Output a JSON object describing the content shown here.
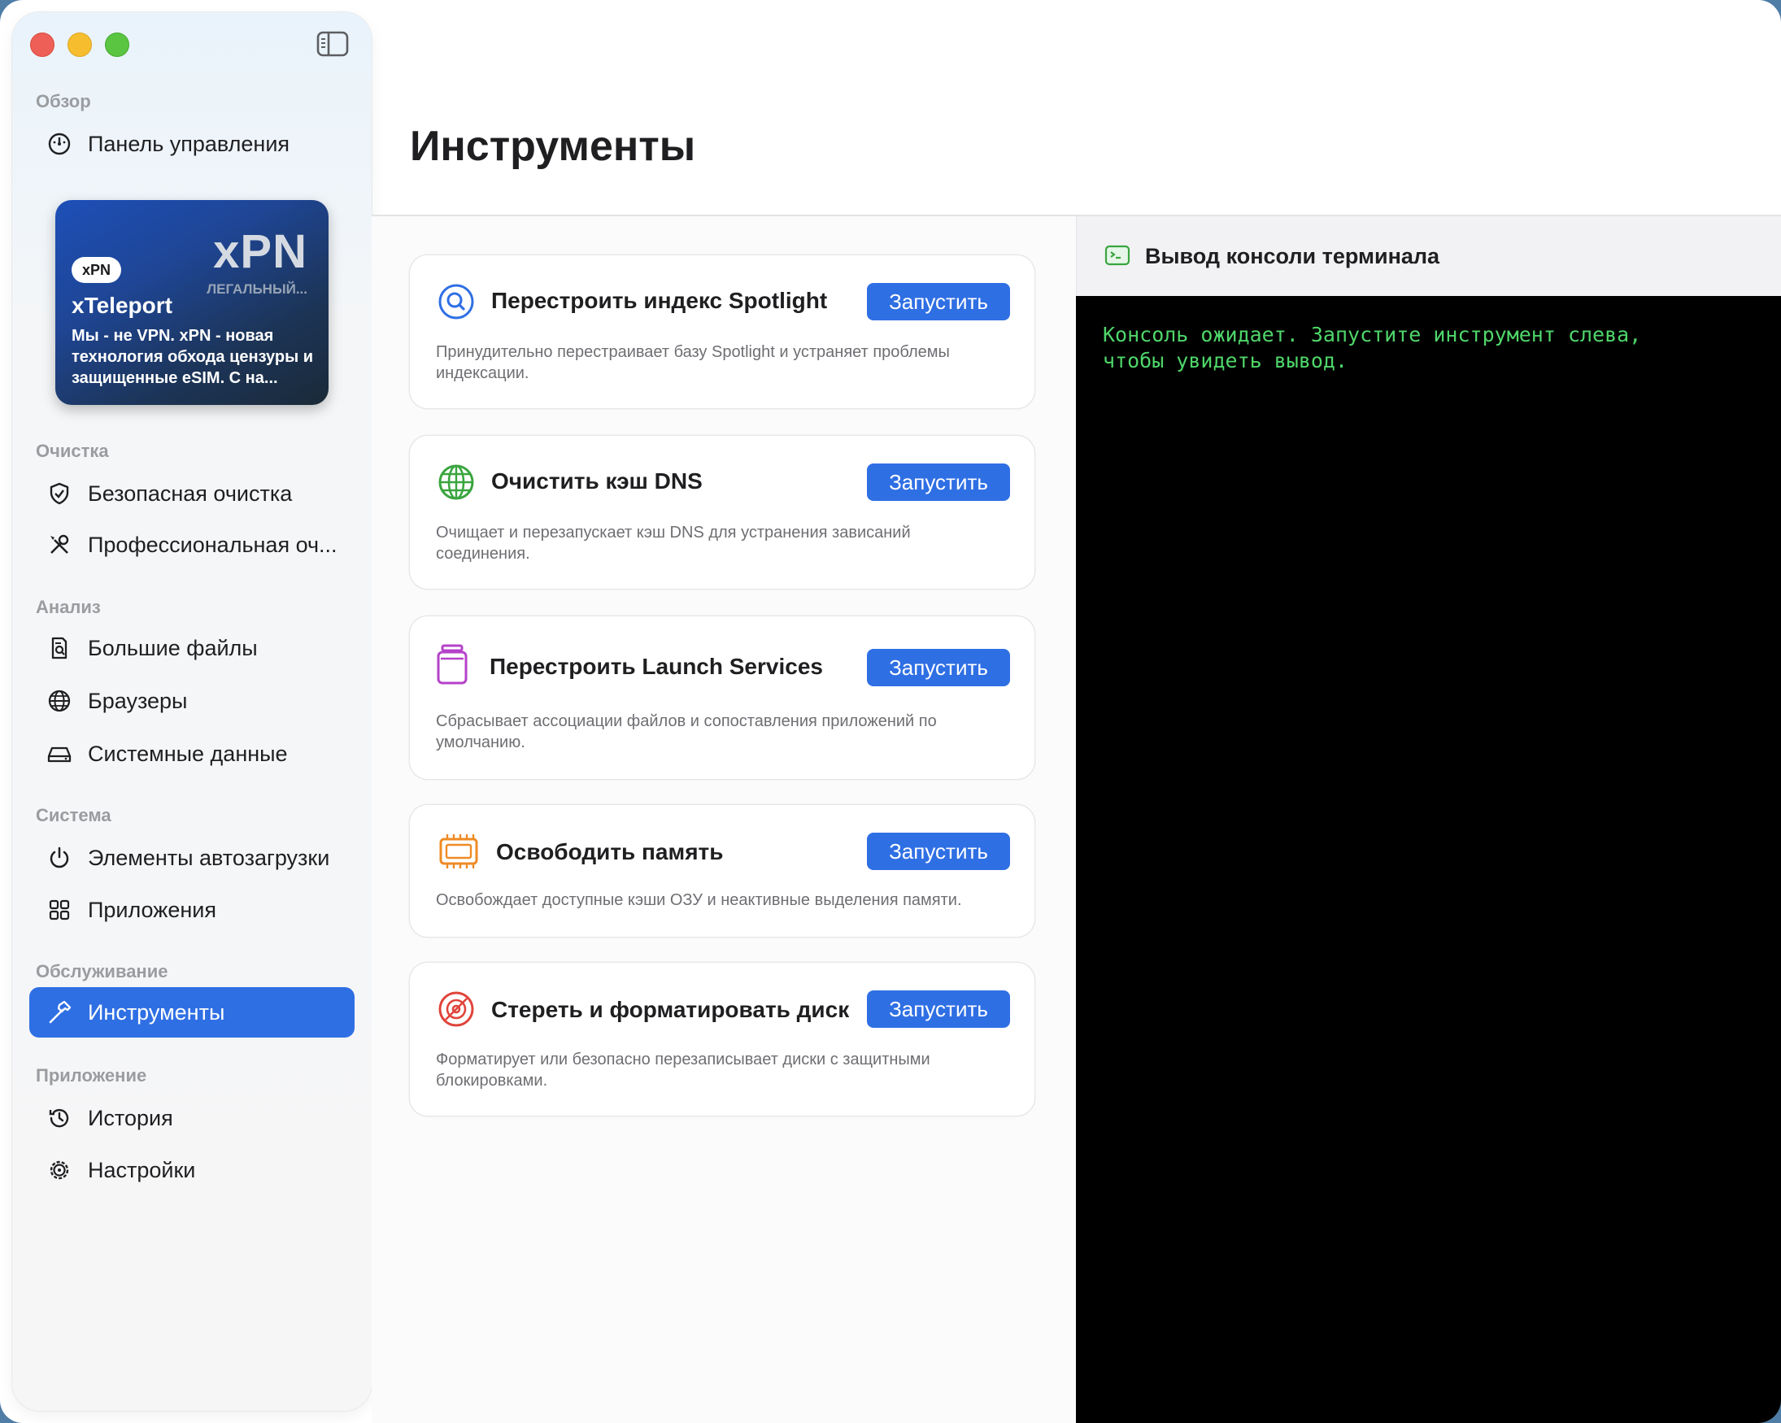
{
  "sidebar": {
    "sections": {
      "overview": "Обзор",
      "cleanup": "Очистка",
      "analysis": "Анализ",
      "system": "Система",
      "maintenance": "Обслуживание",
      "app": "Приложение"
    },
    "items": {
      "dashboard": "Панель управления",
      "safe_clean": "Безопасная очистка",
      "pro_clean": "Профессиональная оч...",
      "large_files": "Большие файлы",
      "browsers": "Браузеры",
      "system_data": "Системные данные",
      "login_items": "Элементы автозагрузки",
      "applications": "Приложения",
      "tools": "Инструменты",
      "history": "История",
      "settings": "Настройки"
    },
    "active_item": "tools",
    "promo": {
      "logo": "xPN",
      "tagline": "ЛЕГАЛЬНЫЙ...",
      "badge": "xPN",
      "title": "xTeleport",
      "description": "Мы - не VPN. xPN - новая технология обхода цензуры и защищенные eSIM. С на..."
    }
  },
  "page": {
    "title": "Инструменты"
  },
  "tools": [
    {
      "title": "Перестроить индекс Spotlight",
      "description": "Принудительно перестраивает базу Spotlight и устраняет проблемы индексации.",
      "button": "Запустить",
      "icon": "spotlight-search-icon",
      "icon_color": "#2f6fe4"
    },
    {
      "title": "Очистить кэш DNS",
      "description": "Очищает и перезапускает кэш DNS для устранения зависаний соединения.",
      "button": "Запустить",
      "icon": "globe-network-icon",
      "icon_color": "#3aa53f"
    },
    {
      "title": "Перестроить Launch Services",
      "description": "Сбрасывает ассоциации файлов и сопоставления приложений по умолчанию.",
      "button": "Запустить",
      "icon": "app-jar-icon",
      "icon_color": "#b542c9"
    },
    {
      "title": "Освободить память",
      "description": "Освобождает доступные кэши ОЗУ и неактивные выделения памяти.",
      "button": "Запустить",
      "icon": "memory-chip-icon",
      "icon_color": "#ef8b25"
    },
    {
      "title": "Стереть и форматировать диск",
      "description": "Форматирует или безопасно перезаписывает диски с защитными блокировками.",
      "button": "Запустить",
      "icon": "disc-erase-icon",
      "icon_color": "#e0443a"
    }
  ],
  "console": {
    "title": "Вывод консоли терминала",
    "output": "Консоль ожидает. Запустите инструмент слева,\nчтобы увидеть вывод."
  },
  "colors": {
    "accent": "#2f6fe4",
    "console_text": "#4fd66a"
  }
}
